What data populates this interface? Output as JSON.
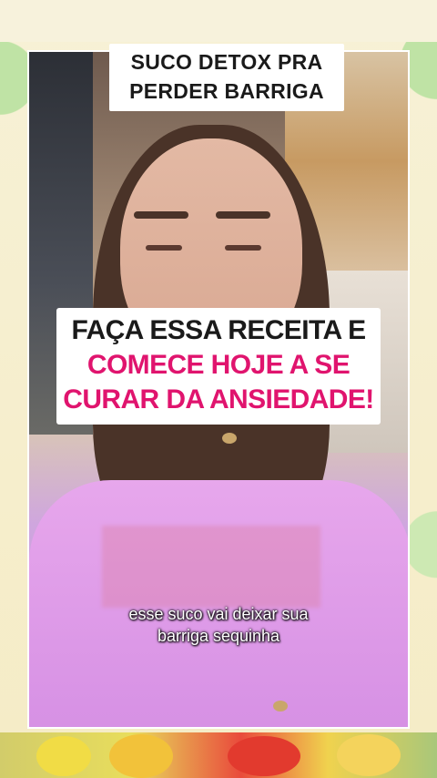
{
  "overlay": {
    "title_line1": "SUCO DETOX PRA",
    "title_line2": "PERDER BARRIGA",
    "headline_line1": "FAÇA ESSA RECEITA E",
    "headline_line2": "COMECE HOJE A SE",
    "headline_line3": "CURAR DA ANSIEDADE!",
    "subtitle_line1": "esse suco vai deixar sua",
    "subtitle_line2": "barriga sequinha"
  },
  "colors": {
    "headline_pink": "#e0146e",
    "headline_dark": "#1a1a1a",
    "caption_bg": "#ffffff",
    "background": "#f6efcf"
  }
}
